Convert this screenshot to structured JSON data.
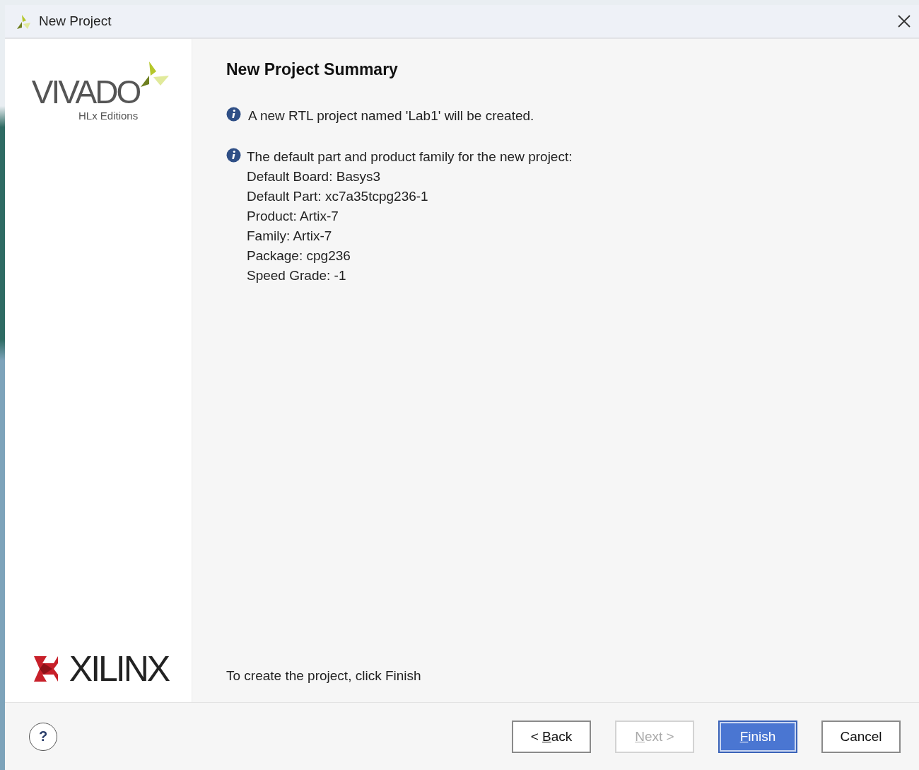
{
  "window": {
    "title": "New Project"
  },
  "sidebar": {
    "product_logo": {
      "name": "VIVADO",
      "subtitle": "HLx Editions"
    },
    "vendor_logo": {
      "name": "XILINX"
    }
  },
  "content": {
    "heading": "New Project Summary",
    "messages": [
      {
        "text": "A new RTL project named 'Lab1' will be created."
      },
      {
        "text": "The default part and product family for the new project:",
        "details": [
          "Default Board: Basys3",
          "Default Part: xc7a35tcpg236-1",
          "Product: Artix-7",
          "Family: Artix-7",
          "Package: cpg236",
          "Speed Grade: -1"
        ]
      }
    ],
    "footer_text": "To create the project, click Finish"
  },
  "help_button": {
    "label": "?"
  },
  "buttons": [
    {
      "before": "< ",
      "mnemonic": "B",
      "after": "ack",
      "disabled": false,
      "default": false
    },
    {
      "mnemonic": "N",
      "after": "ext >",
      "disabled": true,
      "default": false
    },
    {
      "mnemonic": "F",
      "after": "inish",
      "disabled": false,
      "default": true
    },
    {
      "after": "Cancel",
      "disabled": false,
      "default": false
    }
  ]
}
